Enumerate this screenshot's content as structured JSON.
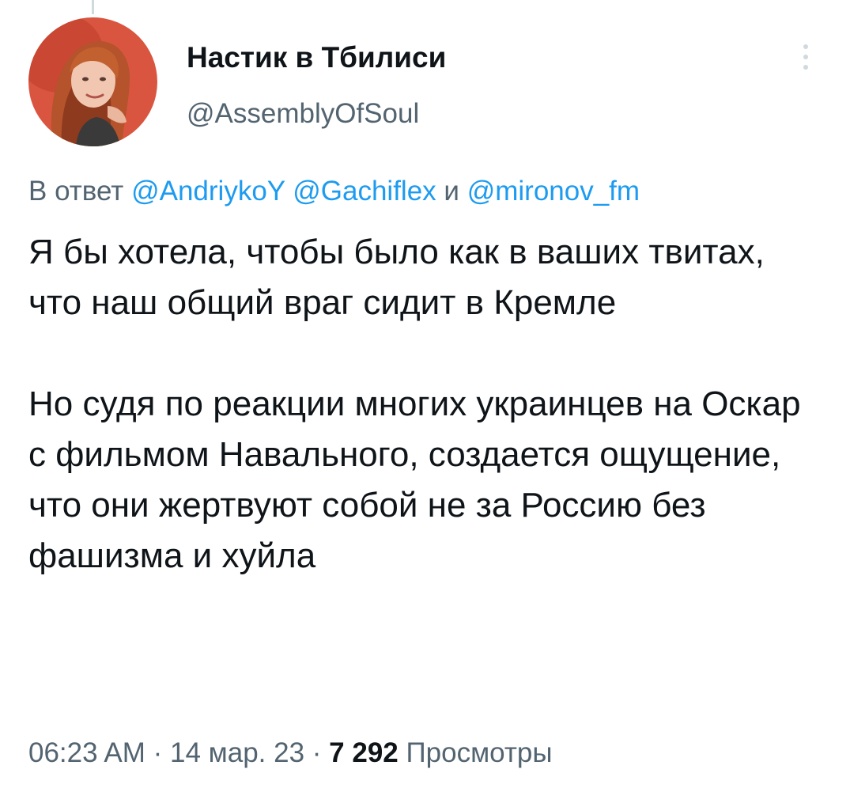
{
  "author": {
    "display_name": "Настик в Тбилиси",
    "handle": "@AssemblyOfSoul"
  },
  "reply": {
    "prefix": "В ответ",
    "mentions": [
      "@AndriykoY",
      "@Gachiflex",
      "@mironov_fm"
    ],
    "conjunction": "и"
  },
  "tweet": {
    "paragraphs": [
      "Я бы хотела, чтобы было как в ваших твитах, что наш общий враг сидит в Кремле",
      "Но судя по реакции многих украинцев на Оскар с фильмом Навального, создается ощущение, что они жертвуют собой не за Россию без фашизма и хуйла"
    ]
  },
  "meta": {
    "time": "06:23 AM",
    "separator": "·",
    "date": "14 мар. 23",
    "views_count": "7 292",
    "views_label": "Просмотры"
  },
  "icons": {
    "more": "more-vertical-icon"
  },
  "colors": {
    "link": "#1d9bf0",
    "secondary_text": "#536471",
    "primary_text": "#0f1419",
    "avatar_background": "#d9553f"
  }
}
